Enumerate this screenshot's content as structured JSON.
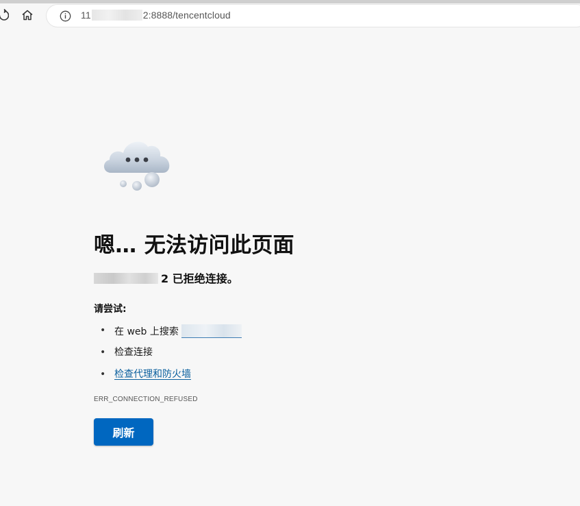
{
  "browser": {
    "url_prefix": "11",
    "url_suffix": "2:8888/tencentcloud",
    "icons": {
      "refresh": "refresh-icon",
      "home": "home-icon",
      "site_info": "info-icon"
    }
  },
  "error_page": {
    "title": "嗯… 无法访问此页面",
    "host_suffix": "2 已拒绝连接。",
    "try_label": "请尝试:",
    "suggestions": [
      {
        "prefix": "在 web 上搜索",
        "type": "search-link"
      },
      {
        "text": "检查连接",
        "type": "text"
      },
      {
        "text": "检查代理和防火墙",
        "type": "link"
      }
    ],
    "error_code": "ERR_CONNECTION_REFUSED",
    "reload_label": "刷新",
    "colors": {
      "accent": "#0067c0",
      "link": "#0a5f9e",
      "background": "#f7f7f7"
    }
  }
}
